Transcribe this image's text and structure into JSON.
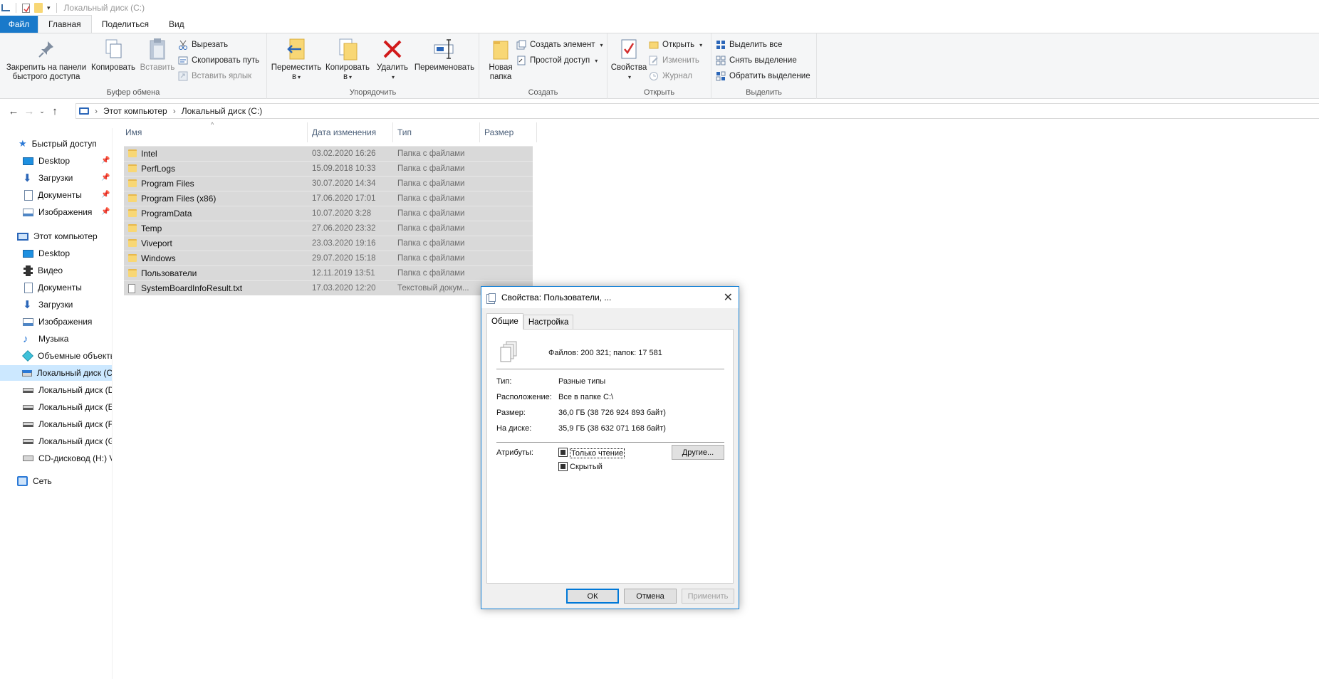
{
  "window": {
    "title": "Локальный диск (C:)"
  },
  "ribbon_tabs": [
    "Файл",
    "Главная",
    "Поделиться",
    "Вид"
  ],
  "ribbon": {
    "clipboard": {
      "label": "Буфер обмена",
      "pin": "Закрепить на панели быстрого доступа",
      "pin_l1": "Закрепить на панели",
      "pin_l2": "быстрого доступа",
      "copy": "Копировать",
      "paste": "Вставить",
      "cut": "Вырезать",
      "copy_path": "Скопировать путь",
      "paste_shortcut": "Вставить ярлык"
    },
    "organize": {
      "label": "Упорядочить",
      "move_l1": "Переместить",
      "move_l2": "в",
      "copy_l1": "Копировать",
      "copy_l2": "в",
      "delete": "Удалить",
      "rename": "Переименовать"
    },
    "create": {
      "label": "Создать",
      "new_folder_l1": "Новая",
      "new_folder_l2": "папка",
      "new_item": "Создать элемент",
      "easy_access": "Простой доступ"
    },
    "open": {
      "label": "Открыть",
      "properties": "Свойства",
      "open": "Открыть",
      "edit": "Изменить",
      "history": "Журнал"
    },
    "select": {
      "label": "Выделить",
      "select_all": "Выделить все",
      "select_none": "Снять выделение",
      "invert": "Обратить выделение"
    }
  },
  "address": {
    "crumbs": [
      "Этот компьютер",
      "Локальный диск (C:)"
    ]
  },
  "sidebar": {
    "quick_access": "Быстрый доступ",
    "quick_items": [
      "Desktop",
      "Загрузки",
      "Документы",
      "Изображения"
    ],
    "this_pc": "Этот компьютер",
    "pc_items": [
      "Desktop",
      "Видео",
      "Документы",
      "Загрузки",
      "Изображения",
      "Музыка",
      "Объемные объекты",
      "Локальный диск (C",
      "Локальный диск (D",
      "Локальный диск (E",
      "Локальный диск (F",
      "Локальный диск (G",
      "CD-дисковод (H:) V"
    ],
    "network": "Сеть"
  },
  "columns": [
    "Имя",
    "Дата изменения",
    "Тип",
    "Размер"
  ],
  "files": [
    {
      "name": "Intel",
      "date": "03.02.2020 16:26",
      "type": "Папка с файлами",
      "icon": "folder-icon"
    },
    {
      "name": "PerfLogs",
      "date": "15.09.2018 10:33",
      "type": "Папка с файлами",
      "icon": "folder-icon"
    },
    {
      "name": "Program Files",
      "date": "30.07.2020 14:34",
      "type": "Папка с файлами",
      "icon": "folder-icon"
    },
    {
      "name": "Program Files (x86)",
      "date": "17.06.2020 17:01",
      "type": "Папка с файлами",
      "icon": "folder-icon"
    },
    {
      "name": "ProgramData",
      "date": "10.07.2020 3:28",
      "type": "Папка с файлами",
      "icon": "folder-icon"
    },
    {
      "name": "Temp",
      "date": "27.06.2020 23:32",
      "type": "Папка с файлами",
      "icon": "folder-icon"
    },
    {
      "name": "Viveport",
      "date": "23.03.2020 19:16",
      "type": "Папка с файлами",
      "icon": "folder-icon"
    },
    {
      "name": "Windows",
      "date": "29.07.2020 15:18",
      "type": "Папка с файлами",
      "icon": "folder-icon"
    },
    {
      "name": "Пользователи",
      "date": "12.11.2019 13:51",
      "type": "Папка с файлами",
      "icon": "folder-icon"
    },
    {
      "name": "SystemBoardInfoResult.txt",
      "date": "17.03.2020 12:20",
      "type": "Текстовый докум...",
      "icon": "text-file-icon"
    }
  ],
  "dialog": {
    "title": "Свойства: Пользователи, ...",
    "tabs": [
      "Общие",
      "Настройка"
    ],
    "summary": "Файлов: 200 321; папок: 17 581",
    "type_label": "Тип:",
    "type_value": "Разные типы",
    "location_label": "Расположение:",
    "location_value": "Все в папке C:\\",
    "size_label": "Размер:",
    "size_value": "36,0 ГБ (38 726 924 893 байт)",
    "disk_label": "На диске:",
    "disk_value": "35,9 ГБ (38 632 071 168 байт)",
    "attr_label": "Атрибуты:",
    "readonly": "Только чтение",
    "hidden": "Скрытый",
    "other": "Другие...",
    "ok": "ОК",
    "cancel": "Отмена",
    "apply": "Применить"
  }
}
